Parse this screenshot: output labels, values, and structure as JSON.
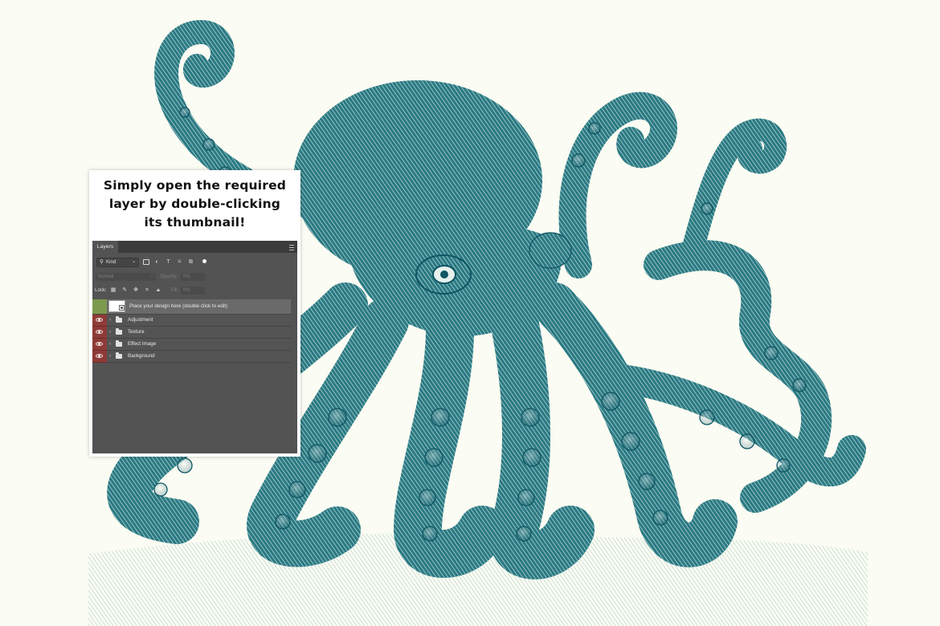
{
  "caption": {
    "line1": "Simply open the required",
    "line2": "layer by double-clicking",
    "line3": "its thumbnail!"
  },
  "layers_panel": {
    "tab_label": "Layers",
    "filter_kind": "Kind",
    "blend_mode": "Normal",
    "opacity_label": "Opacity:",
    "opacity_value": "0%",
    "lock_label": "Lock:",
    "fill_label": "Fill:",
    "fill_value": "0%",
    "layers": [
      {
        "name": "Place your design here (double click to edit)",
        "type": "smart-object",
        "selected": true
      },
      {
        "name": "Adjustment",
        "type": "group",
        "visible": true
      },
      {
        "name": "Texture",
        "type": "group",
        "visible": true
      },
      {
        "name": "Effect Image",
        "type": "group",
        "visible": true
      },
      {
        "name": "Background",
        "type": "group",
        "visible": true
      }
    ]
  },
  "colors": {
    "background": "#fbfcf3",
    "ink": "#1e6b76",
    "ink_dark": "#0f5563",
    "panel": "#535353",
    "eye_red": "#8e3b37",
    "eye_green": "#7c9a4e"
  }
}
